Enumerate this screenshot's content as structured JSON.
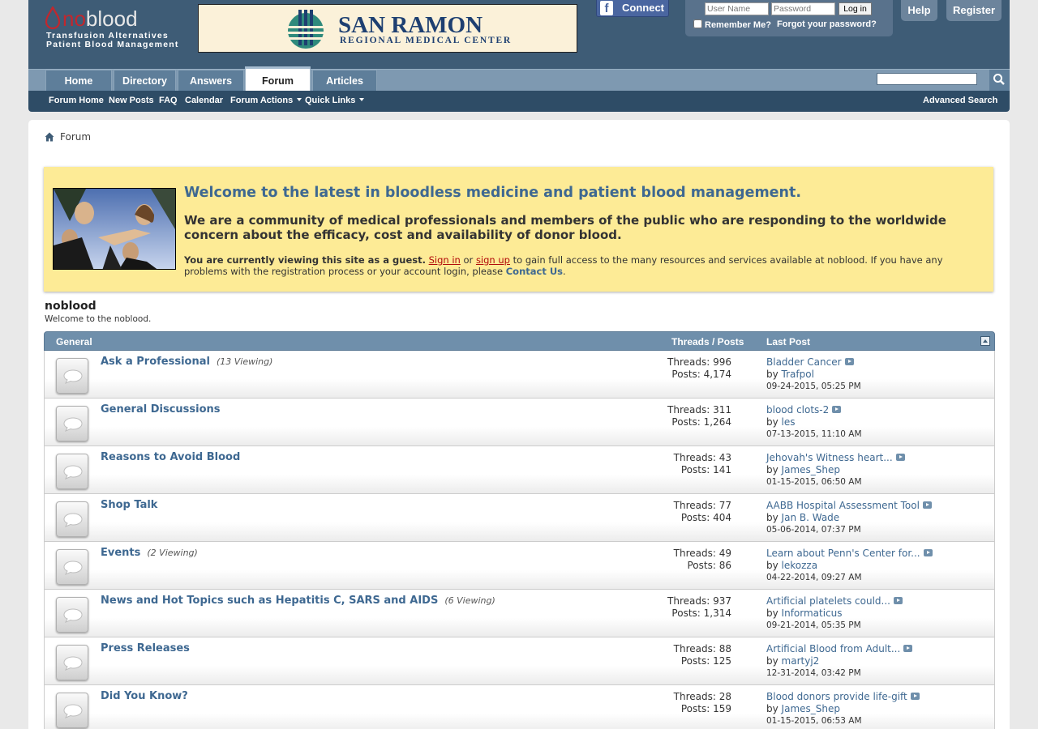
{
  "header": {
    "logo_word_red": "no",
    "logo_word": "blood",
    "tagline1": "Transfusion Alternatives",
    "tagline2": "Patient Blood Management",
    "banner_name": "SAN RAMON",
    "banner_sub": "REGIONAL MEDICAL CENTER",
    "fb_label": "Connect",
    "username_placeholder": "User Name",
    "password_placeholder": "Password",
    "login_button": "Log in",
    "remember_label": "Remember Me?",
    "forgot_label": "Forgot your password?",
    "help": "Help",
    "register": "Register"
  },
  "nav": {
    "tabs": [
      "Home",
      "Directory",
      "Answers",
      "Forum",
      "Articles"
    ],
    "active_tab": "Forum",
    "sub": [
      "Forum Home",
      "New Posts",
      "FAQ",
      "Calendar",
      "Forum Actions",
      "Quick Links"
    ],
    "advanced_search": "Advanced Search"
  },
  "breadcrumb": {
    "current": "Forum"
  },
  "notice": {
    "title": "Welcome to the latest in bloodless medicine and patient blood management.",
    "desc": "We are a community of medical professionals and members of the public who are responding to the worldwide concern about the efficacy, cost and availability of donor blood.",
    "guest_bold": "You are currently viewing this site as a guest.",
    "sign_in": "Sign in",
    "or": "or",
    "sign_up": "sign up",
    "rest": "to gain full access to the many resources and services available at noblood. If you have any problems with the registration process or your account login, please",
    "contact": "Contact Us",
    "period": "."
  },
  "forum": {
    "name": "noblood",
    "desc": "Welcome to the noblood."
  },
  "category": {
    "name": "General",
    "col_threads": "Threads / Posts",
    "col_last": "Last Post"
  },
  "rows": [
    {
      "title": "Ask a Professional",
      "viewing": "(13 Viewing)",
      "threads": "Threads: 996",
      "posts": "Posts: 4,174",
      "last_title": "Bladder Cancer",
      "by": "by",
      "user": "Trafpol",
      "date": "09-24-2015, 05:25 PM"
    },
    {
      "title": "General Discussions",
      "viewing": "",
      "threads": "Threads: 311",
      "posts": "Posts: 1,264",
      "last_title": "blood clots-2",
      "by": "by",
      "user": "les",
      "date": "07-13-2015, 11:10 AM"
    },
    {
      "title": "Reasons to Avoid Blood",
      "viewing": "",
      "threads": "Threads: 43",
      "posts": "Posts: 141",
      "last_title": "Jehovah's Witness heart...",
      "by": "by",
      "user": "James_Shep",
      "date": "01-15-2015, 06:50 AM"
    },
    {
      "title": "Shop Talk",
      "viewing": "",
      "threads": "Threads: 77",
      "posts": "Posts: 404",
      "last_title": "AABB Hospital Assessment Tool",
      "by": "by",
      "user": "Jan B. Wade",
      "date": "05-06-2014, 07:37 PM"
    },
    {
      "title": "Events",
      "viewing": "(2 Viewing)",
      "threads": "Threads: 49",
      "posts": "Posts: 86",
      "last_title": "Learn about Penn's Center for...",
      "by": "by",
      "user": "lekozza",
      "date": "04-22-2014, 09:27 AM"
    },
    {
      "title": "News and Hot Topics such as Hepatitis C, SARS and AIDS",
      "viewing": "(6 Viewing)",
      "threads": "Threads: 937",
      "posts": "Posts: 1,314",
      "last_title": "Artificial platelets could...",
      "by": "by",
      "user": "Informaticus",
      "date": "09-21-2014, 05:35 PM"
    },
    {
      "title": "Press Releases",
      "viewing": "",
      "threads": "Threads: 88",
      "posts": "Posts: 125",
      "last_title": "Artificial Blood from Adult...",
      "by": "by",
      "user": "martyj2",
      "date": "12-31-2014, 03:42 PM"
    },
    {
      "title": "Did You Know?",
      "viewing": "",
      "threads": "Threads: 28",
      "posts": "Posts: 159",
      "last_title": "Blood donors provide life-gift",
      "by": "by",
      "user": "James_Shep",
      "date": "01-15-2015, 06:53 AM"
    }
  ],
  "colors": {
    "header_bg": "#3e5c76",
    "nav_bg": "#7e99b1",
    "subnav_bg": "#2e4c66",
    "link": "#3e6891",
    "notice_bg": "#fdeb96",
    "logo_red": "#c2272d"
  },
  "icons": {
    "home": "home-icon",
    "search": "search-icon",
    "forum": "forum-bubble-icon",
    "goto": "go-to-last-post-icon",
    "collapse": "collapse-icon"
  }
}
